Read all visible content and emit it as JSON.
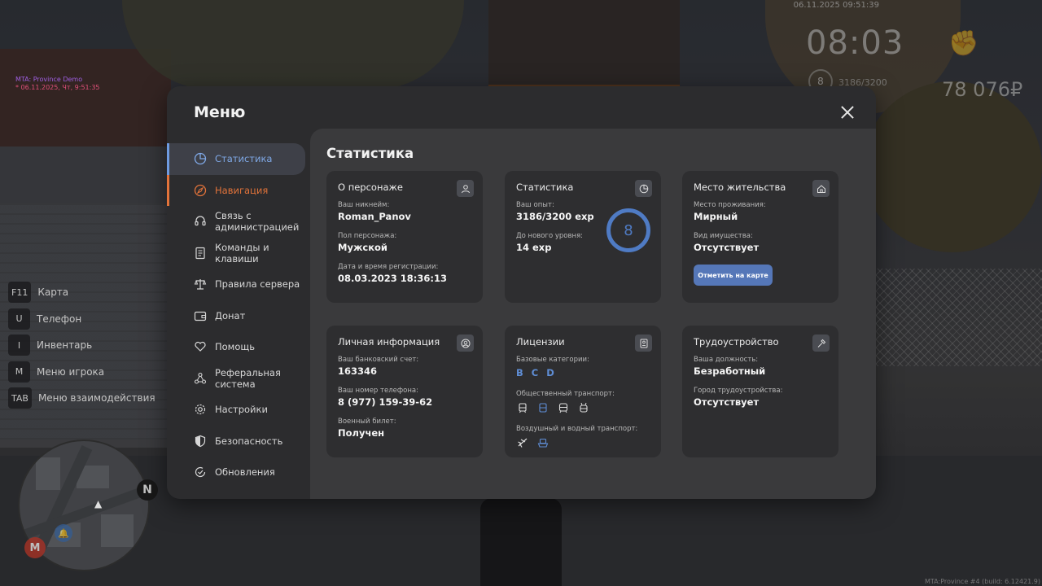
{
  "hud": {
    "server_name": "MTA: Province Demo",
    "server_date": "* 06.11.2025, Чт, 9:51:35",
    "datetime": "06.11.2025 09:51:39",
    "clock": "08:03",
    "level": "8",
    "exp": "3186/3200",
    "money": "78 076₽",
    "build": "MTA:Province #4 (build: 6.12421.9)"
  },
  "hotkeys": [
    {
      "key": "F11",
      "label": "Карта"
    },
    {
      "key": "U",
      "label": "Телефон"
    },
    {
      "key": "I",
      "label": "Инвентарь"
    },
    {
      "key": "M",
      "label": "Меню игрока"
    },
    {
      "key": "TAB",
      "label": "Меню взаимодействия"
    }
  ],
  "minimap": {
    "north": "N",
    "metro": "M"
  },
  "modal": {
    "title": "Меню",
    "nav": [
      {
        "label": "Статистика",
        "icon": "pie-chart-icon"
      },
      {
        "label": "Навигация",
        "icon": "compass-icon"
      },
      {
        "label": "Связь с администрацией",
        "icon": "headset-icon"
      },
      {
        "label": "Команды и клавиши",
        "icon": "document-icon"
      },
      {
        "label": "Правила сервера",
        "icon": "scales-icon"
      },
      {
        "label": "Донат",
        "icon": "wallet-icon"
      },
      {
        "label": "Помощь",
        "icon": "heart-hand-icon"
      },
      {
        "label": "Реферальная система",
        "icon": "network-icon"
      },
      {
        "label": "Настройки",
        "icon": "gear-icon"
      },
      {
        "label": "Безопасность",
        "icon": "shield-icon"
      },
      {
        "label": "Обновления",
        "icon": "refresh-check-icon"
      }
    ],
    "content_title": "Статистика",
    "character": {
      "title": "О персонаже",
      "nickname_label": "Ваш никнейм:",
      "nickname": "Roman_Panov",
      "gender_label": "Пол персонажа:",
      "gender": "Мужской",
      "reg_label": "Дата и время регистрации:",
      "reg_date": "08.03.2023 18:36:13"
    },
    "stats": {
      "title": "Статистика",
      "exp_label": "Ваш опыт:",
      "exp": "3186/3200 exp",
      "next_label": "До нового уровня:",
      "next": "14 exp",
      "level": "8"
    },
    "residence": {
      "title": "Место жительства",
      "place_label": "Место проживания:",
      "place": "Мирный",
      "property_label": "Вид имущества:",
      "property": "Отсутствует",
      "map_button": "Отметить на карте"
    },
    "personal": {
      "title": "Личная информация",
      "bank_label": "Ваш банковский счет:",
      "bank": "163346",
      "phone_label": "Ваш номер телефона:",
      "phone": "8 (977) 159-39-62",
      "military_label": "Военный билет:",
      "military": "Получен"
    },
    "licenses": {
      "title": "Лицензии",
      "base_label": "Базовые категории:",
      "categories": [
        "B",
        "C",
        "D"
      ],
      "public_label": "Общественный транспорт:",
      "air_label": "Воздушный и водный транспорт:"
    },
    "employment": {
      "title": "Трудоустройство",
      "position_label": "Ваша должность:",
      "position": "Безработный",
      "city_label": "Город трудоустройства:",
      "city": "Отсутствует"
    }
  },
  "colors": {
    "accent": "#5f8ed6",
    "nav_active": "#7fa8e6",
    "nav_orange": "#e2733a"
  }
}
